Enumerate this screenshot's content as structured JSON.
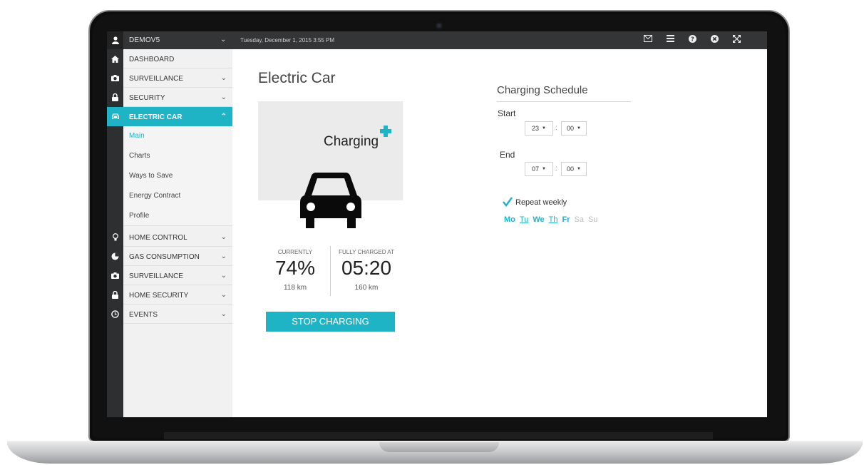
{
  "topbar": {
    "user": "DEMOV5",
    "datetime": "Tuesday, December 1, 2015 3:55 PM",
    "icons": [
      "mail-icon",
      "list-icon",
      "help-icon",
      "close-icon",
      "fullscreen-icon"
    ]
  },
  "sidebar": {
    "items": [
      {
        "label": "DASHBOARD",
        "icon": "home-icon"
      },
      {
        "label": "SURVEILLANCE",
        "icon": "camera-icon"
      },
      {
        "label": "SECURITY",
        "icon": "lock-icon"
      },
      {
        "label": "ELECTRIC CAR",
        "icon": "car-icon",
        "active": true
      },
      {
        "label": "HOME CONTROL",
        "icon": "bulb-icon"
      },
      {
        "label": "GAS CONSUMPTION",
        "icon": "pie-icon"
      },
      {
        "label": "SURVEILLANCE",
        "icon": "camera-icon"
      },
      {
        "label": "HOME SECURITY",
        "icon": "lock-icon"
      },
      {
        "label": "EVENTS",
        "icon": "clock-icon"
      }
    ],
    "sub_items": [
      "Main",
      "Charts",
      "Ways to Save",
      "Energy Contract",
      "Profile"
    ]
  },
  "main": {
    "title": "Electric Car",
    "status": "Charging",
    "current_label": "CURRENTLY",
    "current_value": "74%",
    "current_range": "118 km",
    "full_label": "FULLY CHARGED AT",
    "full_value": "05:20",
    "full_range": "160 km",
    "stop_button": "STOP CHARGING"
  },
  "schedule": {
    "title": "Charging Schedule",
    "start_label": "Start",
    "start_hour": "23",
    "start_min": "00",
    "end_label": "End",
    "end_hour": "07",
    "end_min": "00",
    "separator": ":",
    "repeat_label": "Repeat weekly",
    "days": [
      {
        "label": "Mo",
        "on": true
      },
      {
        "label": "Tu",
        "on": true,
        "underline": true
      },
      {
        "label": "We",
        "on": true
      },
      {
        "label": "Th",
        "on": true,
        "underline": true
      },
      {
        "label": "Fr",
        "on": true
      },
      {
        "label": "Sa",
        "on": false
      },
      {
        "label": "Su",
        "on": false
      }
    ]
  },
  "colors": {
    "accent": "#1fb3c6",
    "topbar": "#333537",
    "sidebar": "#f1f1f2"
  }
}
